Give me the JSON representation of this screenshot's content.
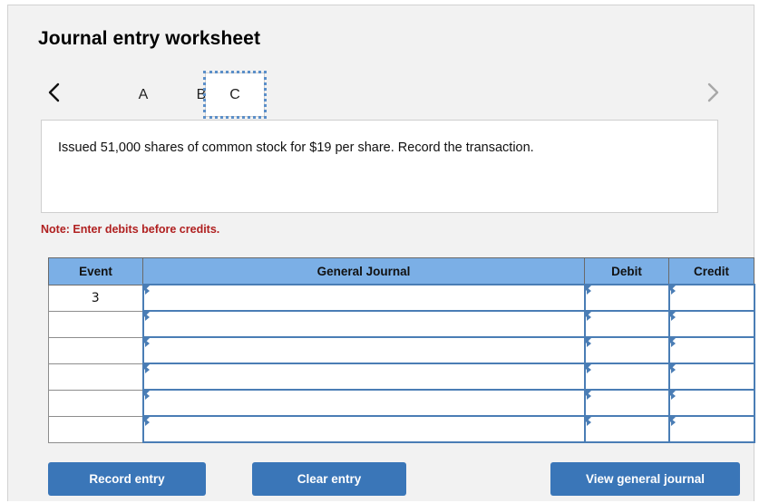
{
  "page": {
    "title": "Journal entry worksheet"
  },
  "tabs": {
    "prev_icon": "chevron-left-icon",
    "next_icon": "chevron-right-icon",
    "items": [
      {
        "label": "A",
        "selected": false
      },
      {
        "label": "B",
        "selected": false
      },
      {
        "label": "C",
        "selected": true
      }
    ]
  },
  "description": {
    "text": "Issued 51,000 shares of common stock for $19 per share. Record the transaction."
  },
  "note": {
    "text": "Note: Enter debits before credits."
  },
  "journal": {
    "headers": [
      "Event",
      "General Journal",
      "Debit",
      "Credit"
    ],
    "rows": [
      {
        "event": "3",
        "general_journal": "",
        "debit": "",
        "credit": ""
      },
      {
        "event": "",
        "general_journal": "",
        "debit": "",
        "credit": ""
      },
      {
        "event": "",
        "general_journal": "",
        "debit": "",
        "credit": ""
      },
      {
        "event": "",
        "general_journal": "",
        "debit": "",
        "credit": ""
      },
      {
        "event": "",
        "general_journal": "",
        "debit": "",
        "credit": ""
      },
      {
        "event": "",
        "general_journal": "",
        "debit": "",
        "credit": ""
      }
    ]
  },
  "buttons": {
    "record": "Record entry",
    "clear": "Clear entry",
    "view": "View general journal"
  },
  "colors": {
    "page_background": "#f2f2f2",
    "header_blue": "#7bafe6",
    "button_blue": "#3a76b8",
    "cell_border_blue": "#4a7db5",
    "note_red": "#b02020",
    "focus_outline": "#5b8fc9"
  }
}
